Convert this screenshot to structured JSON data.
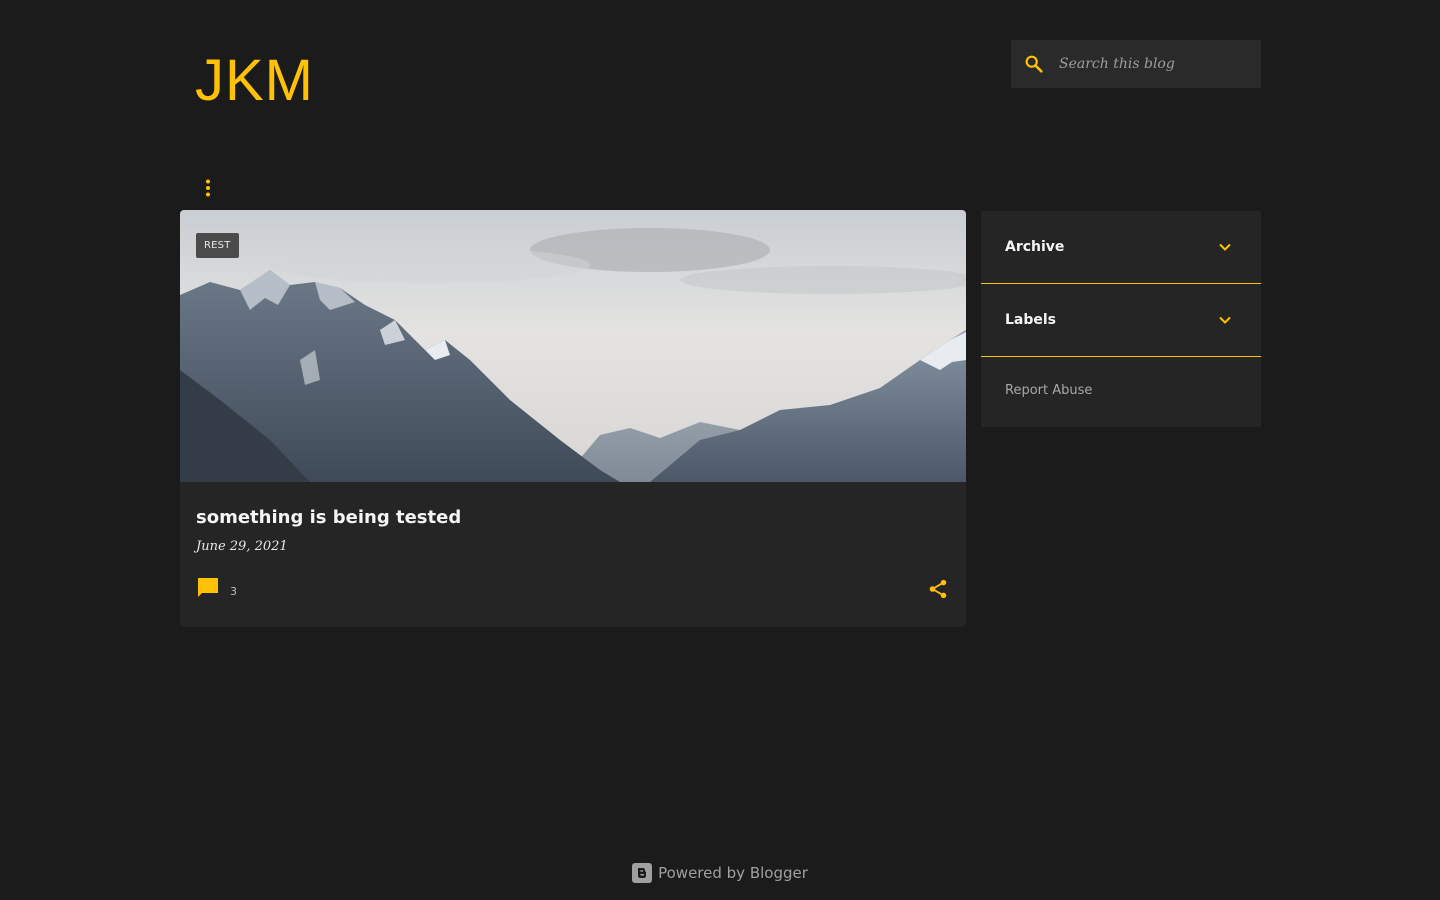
{
  "colors": {
    "accent": "#ffc107",
    "background": "#1b1b1b",
    "card": "#252525"
  },
  "header": {
    "title": "JKM"
  },
  "search": {
    "placeholder": "Search this blog",
    "icon": "search-icon"
  },
  "menu": {
    "icon": "more-vert-icon"
  },
  "post": {
    "label": "REST",
    "title": "something is being tested",
    "date": "June 29, 2021",
    "comment_count": "3",
    "comment_icon": "comment-icon",
    "share_icon": "share-icon"
  },
  "sidebar": {
    "sections": [
      {
        "label": "Archive",
        "icon": "chevron-down-icon"
      },
      {
        "label": "Labels",
        "icon": "chevron-down-icon"
      }
    ],
    "report_abuse": "Report Abuse"
  },
  "footer": {
    "text": "Powered by Blogger",
    "icon": "blogger-icon"
  }
}
